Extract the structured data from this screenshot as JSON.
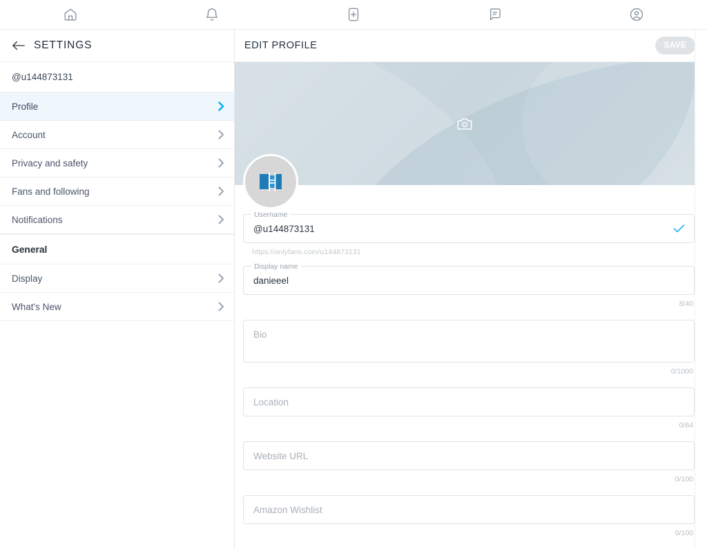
{
  "topnav": {
    "items": [
      {
        "name": "home-icon",
        "label": "Home"
      },
      {
        "name": "notifications-icon",
        "label": "Notifications"
      },
      {
        "name": "new-post-icon",
        "label": "New post"
      },
      {
        "name": "messages-icon",
        "label": "Messages"
      },
      {
        "name": "profile-icon",
        "label": "Profile"
      }
    ]
  },
  "sidebar": {
    "title": "SETTINGS",
    "back_icon": "arrow-left-icon",
    "account_handle": "@u144873131",
    "items": [
      {
        "label": "Profile",
        "active": true
      },
      {
        "label": "Account",
        "active": false
      },
      {
        "label": "Privacy and safety",
        "active": false
      },
      {
        "label": "Fans and following",
        "active": false
      },
      {
        "label": "Notifications",
        "active": false
      }
    ],
    "section_general": "General",
    "general_items": [
      {
        "label": "Display"
      },
      {
        "label": "What's New"
      }
    ]
  },
  "content": {
    "title": "EDIT PROFILE",
    "save_label": "SAVE",
    "banner": {
      "camera_icon": "camera-icon",
      "gradient_from": "#cfdbe2",
      "gradient_to": "#d2dde3"
    },
    "avatar": {
      "icon": "broken-image-icon",
      "bg": "#d7d7d7"
    },
    "fields": [
      {
        "id": "username",
        "label": "Username",
        "value": "@u144873131",
        "placeholder": "Username",
        "filled": true,
        "valid_icon": "check-icon",
        "helper": "https://onlyfans.com/u144873131",
        "counter": "",
        "multiline": false
      },
      {
        "id": "display-name",
        "label": "Display name",
        "value": "danieeel",
        "placeholder": "Display name",
        "filled": true,
        "valid_icon": "",
        "helper": "",
        "counter": "8/40",
        "multiline": false
      },
      {
        "id": "bio",
        "label": "",
        "value": "",
        "placeholder": "Bio",
        "filled": false,
        "valid_icon": "",
        "helper": "",
        "counter": "0/1000",
        "multiline": true
      },
      {
        "id": "location",
        "label": "",
        "value": "",
        "placeholder": "Location",
        "filled": false,
        "valid_icon": "",
        "helper": "",
        "counter": "0/64",
        "multiline": false
      },
      {
        "id": "website-url",
        "label": "",
        "value": "",
        "placeholder": "Website URL",
        "filled": false,
        "valid_icon": "",
        "helper": "",
        "counter": "0/100",
        "multiline": false
      },
      {
        "id": "amazon-wishlist",
        "label": "",
        "value": "",
        "placeholder": "Amazon Wishlist",
        "filled": false,
        "valid_icon": "",
        "helper": "",
        "counter": "0/100",
        "multiline": false
      }
    ]
  },
  "colors": {
    "accent": "#00aff0",
    "active_row_bg": "#eff7fd",
    "text_dark": "#222f3e",
    "text_muted": "#9aa3ab",
    "border": "#dfe3e6"
  }
}
